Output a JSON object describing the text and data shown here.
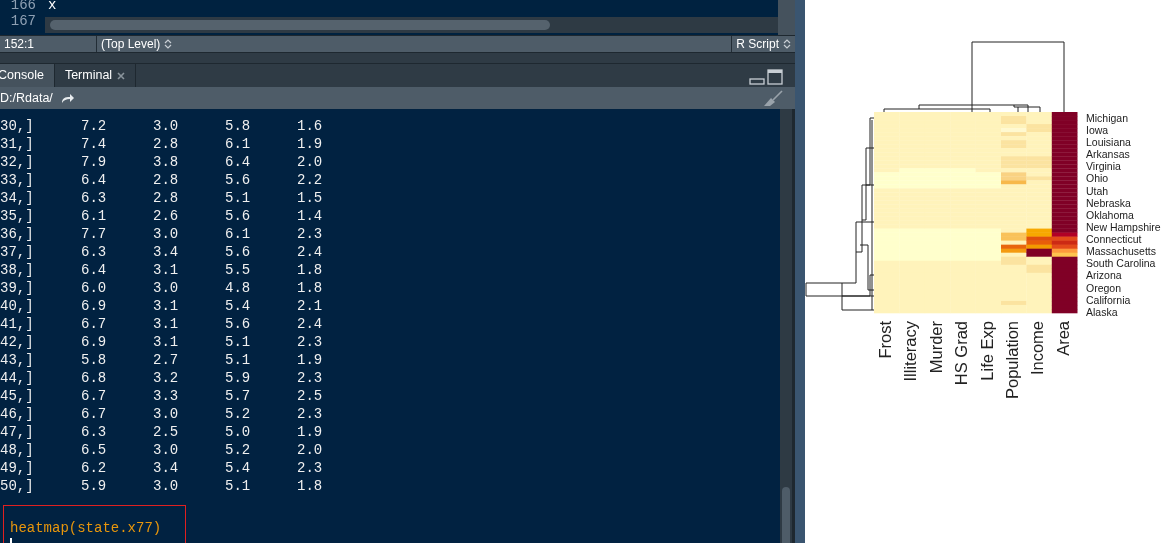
{
  "editor": {
    "lines": [
      {
        "number": "166",
        "code": "x"
      },
      {
        "number": "167"
      }
    ]
  },
  "status_bar": {
    "position": "152:1",
    "scope": "(Top Level)",
    "file_type": "R Script"
  },
  "console": {
    "tabs": [
      {
        "label": "Console",
        "selected": true,
        "closable": false
      },
      {
        "label": "Terminal",
        "selected": false,
        "closable": true
      }
    ],
    "path": "D:/Rdata/",
    "rows": [
      {
        "index": "30,]",
        "values": [
          "7.2",
          "3.0",
          "5.8",
          "1.6"
        ]
      },
      {
        "index": "31,]",
        "values": [
          "7.4",
          "2.8",
          "6.1",
          "1.9"
        ]
      },
      {
        "index": "32,]",
        "values": [
          "7.9",
          "3.8",
          "6.4",
          "2.0"
        ]
      },
      {
        "index": "33,]",
        "values": [
          "6.4",
          "2.8",
          "5.6",
          "2.2"
        ]
      },
      {
        "index": "34,]",
        "values": [
          "6.3",
          "2.8",
          "5.1",
          "1.5"
        ]
      },
      {
        "index": "35,]",
        "values": [
          "6.1",
          "2.6",
          "5.6",
          "1.4"
        ]
      },
      {
        "index": "36,]",
        "values": [
          "7.7",
          "3.0",
          "6.1",
          "2.3"
        ]
      },
      {
        "index": "37,]",
        "values": [
          "6.3",
          "3.4",
          "5.6",
          "2.4"
        ]
      },
      {
        "index": "38,]",
        "values": [
          "6.4",
          "3.1",
          "5.5",
          "1.8"
        ]
      },
      {
        "index": "39,]",
        "values": [
          "6.0",
          "3.0",
          "4.8",
          "1.8"
        ]
      },
      {
        "index": "40,]",
        "values": [
          "6.9",
          "3.1",
          "5.4",
          "2.1"
        ]
      },
      {
        "index": "41,]",
        "values": [
          "6.7",
          "3.1",
          "5.6",
          "2.4"
        ]
      },
      {
        "index": "42,]",
        "values": [
          "6.9",
          "3.1",
          "5.1",
          "2.3"
        ]
      },
      {
        "index": "43,]",
        "values": [
          "5.8",
          "2.7",
          "5.1",
          "1.9"
        ]
      },
      {
        "index": "44,]",
        "values": [
          "6.8",
          "3.2",
          "5.9",
          "2.3"
        ]
      },
      {
        "index": "45,]",
        "values": [
          "6.7",
          "3.3",
          "5.7",
          "2.5"
        ]
      },
      {
        "index": "46,]",
        "values": [
          "6.7",
          "3.0",
          "5.2",
          "2.3"
        ]
      },
      {
        "index": "47,]",
        "values": [
          "6.3",
          "2.5",
          "5.0",
          "1.9"
        ]
      },
      {
        "index": "48,]",
        "values": [
          "6.5",
          "3.0",
          "5.2",
          "2.0"
        ]
      },
      {
        "index": "49,]",
        "values": [
          "6.2",
          "3.4",
          "5.4",
          "2.3"
        ]
      },
      {
        "index": "50,]",
        "values": [
          "5.9",
          "3.0",
          "5.1",
          "1.8"
        ]
      }
    ],
    "command": "heatmap(state.x77)"
  },
  "plot": {
    "row_labels": [
      "Michigan",
      "Iowa",
      "Louisiana",
      "Arkansas",
      "Virginia",
      "Ohio",
      "Utah",
      "Nebraska",
      "Oklahoma",
      "New Hampshire",
      "Connecticut",
      "Massachusetts",
      "South Carolina",
      "Arizona",
      "Oregon",
      "California",
      "Alaska"
    ],
    "column_labels": [
      "Frost",
      "Illiteracy",
      "Murder",
      "HS Grad",
      "Life Exp",
      "Population",
      "Income",
      "Area"
    ]
  }
}
